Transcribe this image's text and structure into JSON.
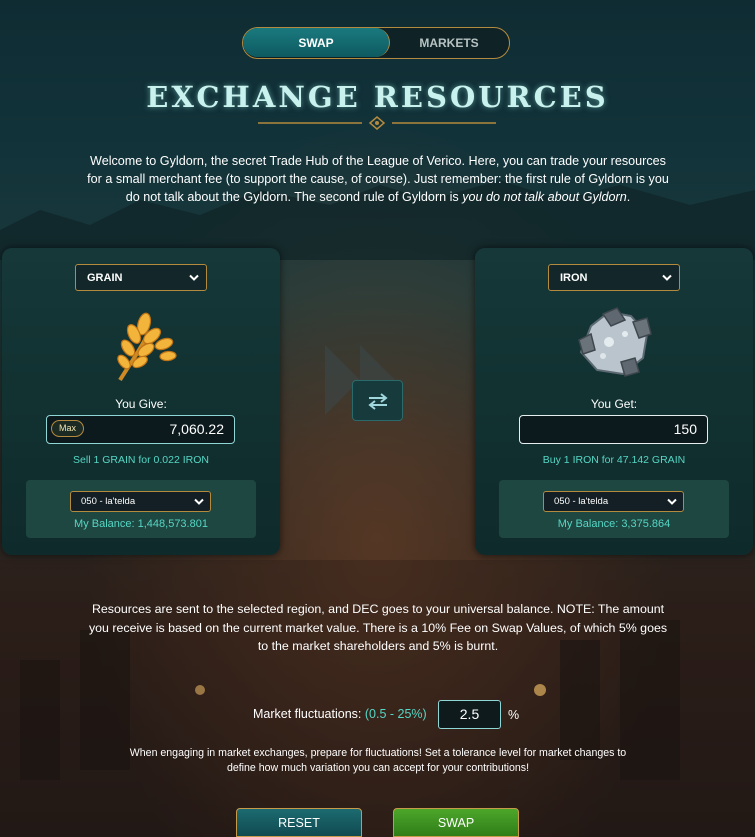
{
  "tabs": {
    "swap_label": "SWAP",
    "markets_label": "MARKETS",
    "active": "SWAP"
  },
  "header": {
    "title": "EXCHANGE RESOURCES"
  },
  "intro": {
    "text_main": "Welcome to Gyldorn, the secret Trade Hub of the League of Verico. Here, you can trade your resources for a small merchant fee (to support the cause, of course). Just remember: the first rule of Gyldorn is you do not talk about the Gyldorn. The second rule of Gyldorn is ",
    "text_italic": "you do not talk about Gyldorn",
    "text_end": "."
  },
  "give": {
    "resource": "GRAIN",
    "label": "You Give:",
    "max_label": "Max",
    "amount": "7,060.22",
    "rate": "Sell 1 GRAIN for 0.022 IRON",
    "region": "050 - la'telda",
    "balance": "My Balance: 1,448,573.801"
  },
  "get": {
    "resource": "IRON",
    "label": "You Get:",
    "amount": "150",
    "rate": "Buy 1 IRON for 47.142 GRAIN",
    "region": "050 - la'telda",
    "balance": "My Balance: 3,375.864"
  },
  "swap_direction_icon": "swap-arrows-icon",
  "note": "Resources are sent to the selected region, and DEC goes to your universal balance. NOTE: The amount you receive is based on the current market value. There is a 10% Fee on Swap Values, of which 5% goes to the market shareholders and 5% is burnt.",
  "fluctuation": {
    "label": "Market fluctuations:",
    "range": "(0.5 - 25%)",
    "value": "2.5",
    "unit": "%"
  },
  "caution": "When engaging in market exchanges, prepare for fluctuations! Set a tolerance level for market changes to define how much variation you can accept for your contributions!",
  "buttons": {
    "reset": "RESET",
    "swap": "SWAP"
  },
  "colors": {
    "accent_teal": "#55d7c5",
    "gold_border": "#b48a3e",
    "swap_green": "#3e9322"
  }
}
